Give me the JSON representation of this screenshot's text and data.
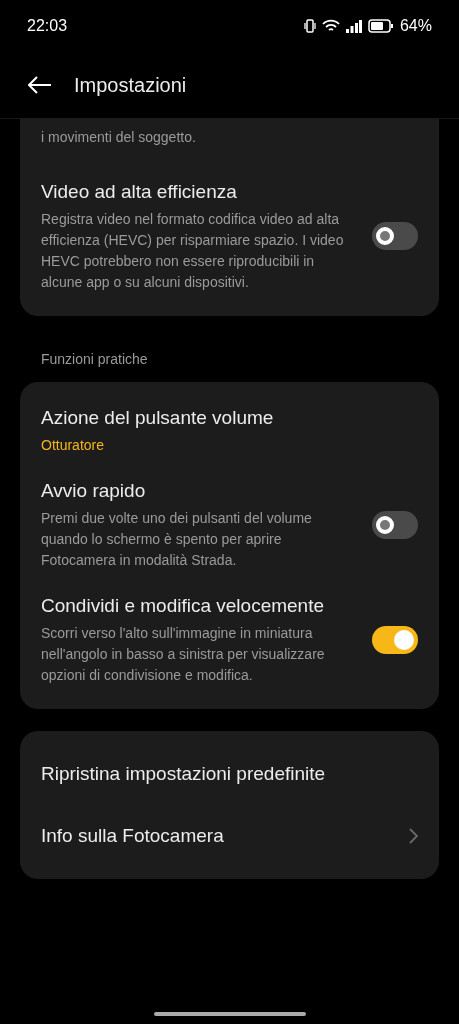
{
  "status_bar": {
    "time": "22:03",
    "battery": "64%"
  },
  "header": {
    "title": "Impostazioni"
  },
  "sections": [
    {
      "cards": [
        {
          "continuation": "i movimenti del soggetto.",
          "items": [
            {
              "kind": "toggle",
              "title": "Video ad alta efficienza",
              "description": "Registra video nel formato codifica video ad alta efficienza (HEVC) per risparmiare spazio. I video HEVC potrebbero non essere riproducibili in alcune app o su alcuni dispositivi.",
              "on": false
            }
          ]
        }
      ]
    },
    {
      "label": "Funzioni pratiche",
      "cards": [
        {
          "items": [
            {
              "kind": "value",
              "title": "Azione del pulsante volume",
              "value": "Otturatore"
            },
            {
              "kind": "toggle",
              "title": "Avvio rapido",
              "description": "Premi due volte uno dei pulsanti del volume quando lo schermo è spento per aprire Fotocamera in modalità Strada.",
              "on": false
            },
            {
              "kind": "toggle",
              "title": "Condividi e modifica velocemente",
              "description": "Scorri verso l'alto sull'immagine in miniatura nell'angolo in basso a sinistra per visualizzare opzioni di condivisione e modifica.",
              "on": true
            }
          ]
        },
        {
          "items": [
            {
              "kind": "plain",
              "title": "Ripristina impostazioni predefinite"
            },
            {
              "kind": "link",
              "title": "Info sulla Fotocamera"
            }
          ]
        }
      ]
    }
  ]
}
